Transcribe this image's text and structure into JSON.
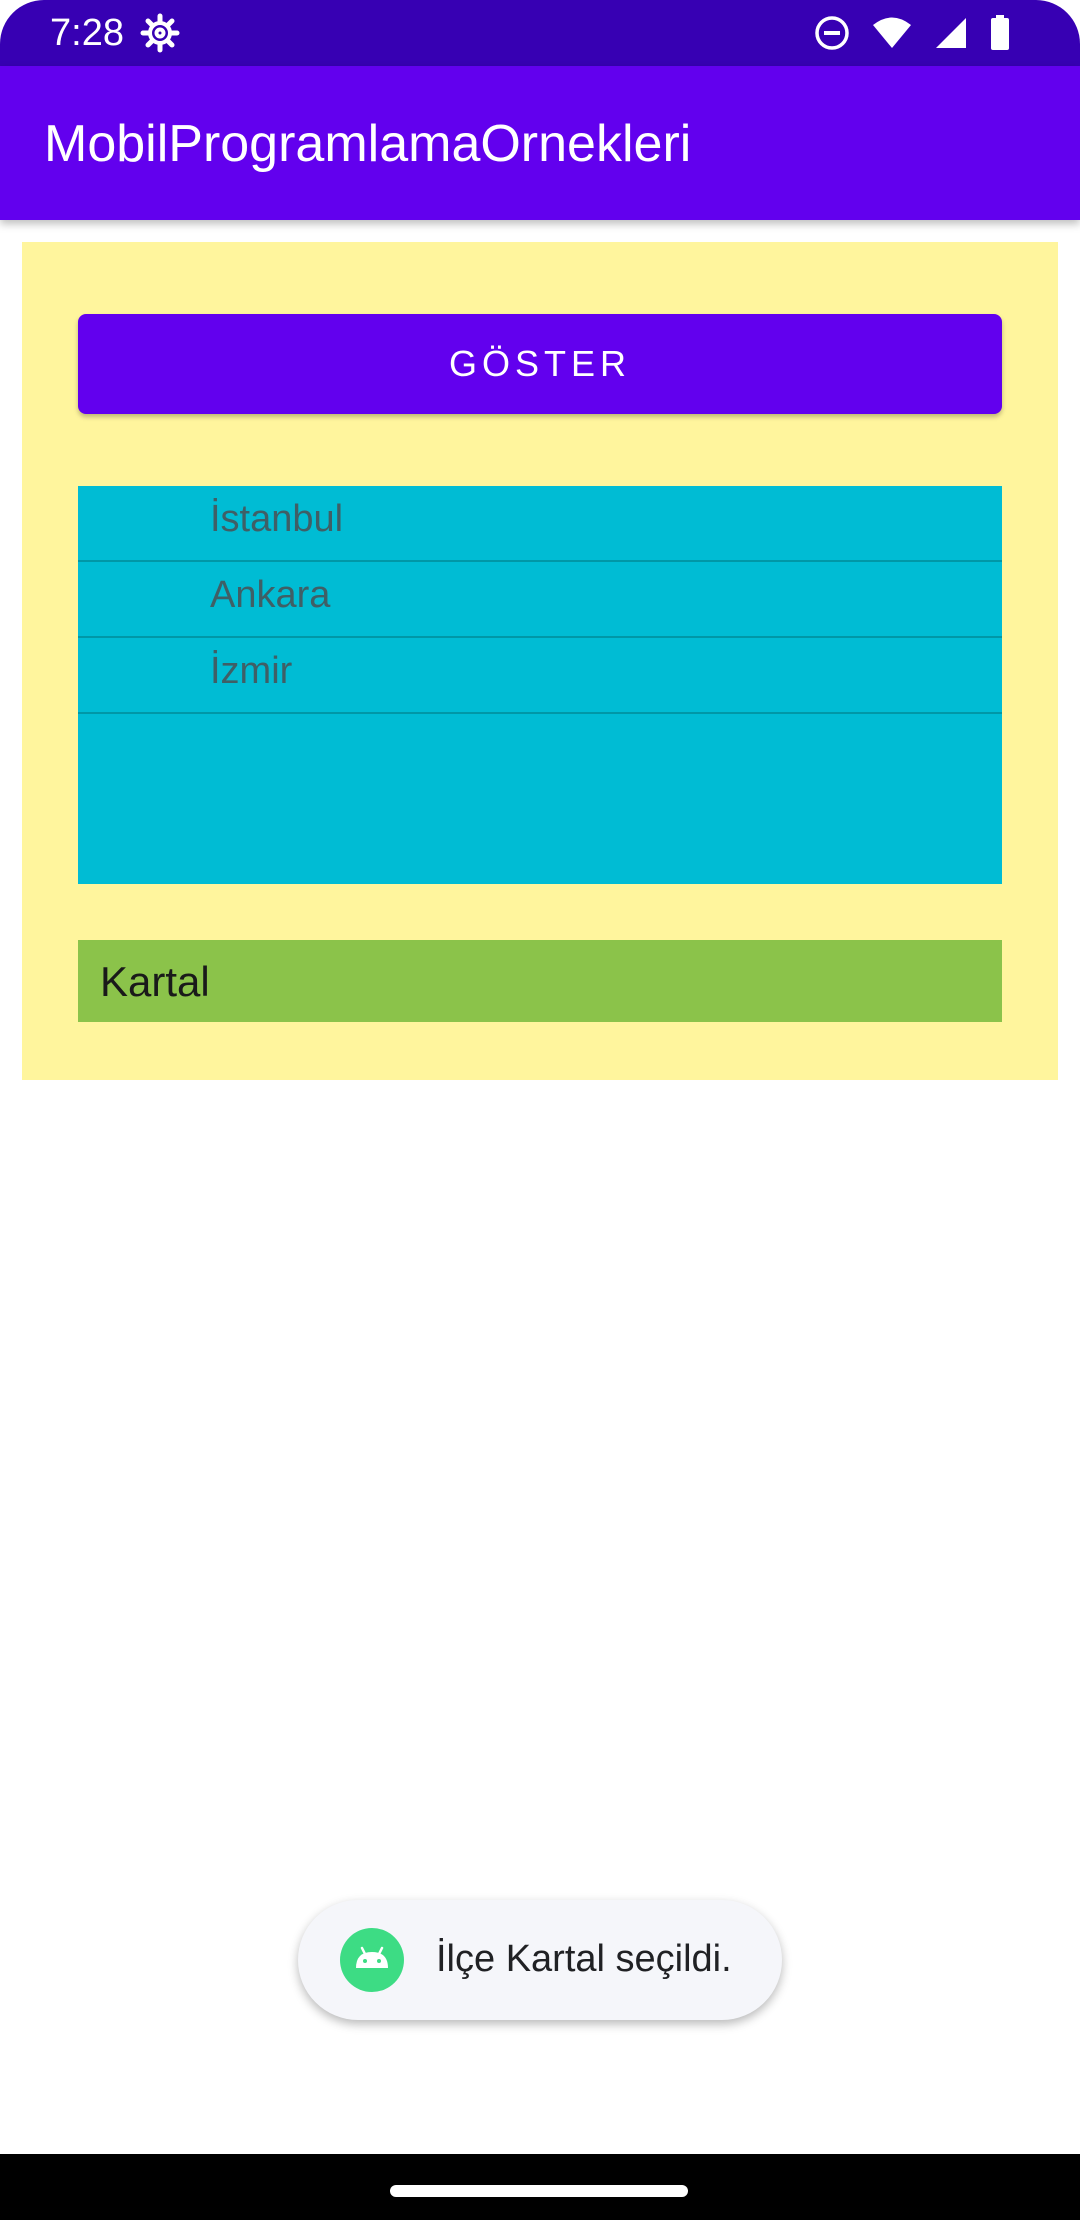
{
  "status_bar": {
    "time": "7:28",
    "icons": [
      "settings-gear-icon",
      "do-not-disturb-icon",
      "wifi-icon",
      "cell-signal-icon",
      "battery-icon"
    ]
  },
  "app_bar": {
    "title": "MobilProgramlamaOrnekleri"
  },
  "main": {
    "show_button_label": "GÖSTER",
    "cities": [
      {
        "label": "İstanbul"
      },
      {
        "label": "Ankara"
      },
      {
        "label": "İzmir"
      }
    ],
    "selected_district": "Kartal"
  },
  "toast": {
    "icon": "android-icon",
    "message": "İlçe Kartal seçildi."
  },
  "colors": {
    "status_bar": "#3700B3",
    "primary": "#6200EE",
    "content_background": "#FFF59D",
    "list_background": "#00BCD4",
    "selected_background": "#8BC34A",
    "toast_background": "#F5F6FA"
  }
}
